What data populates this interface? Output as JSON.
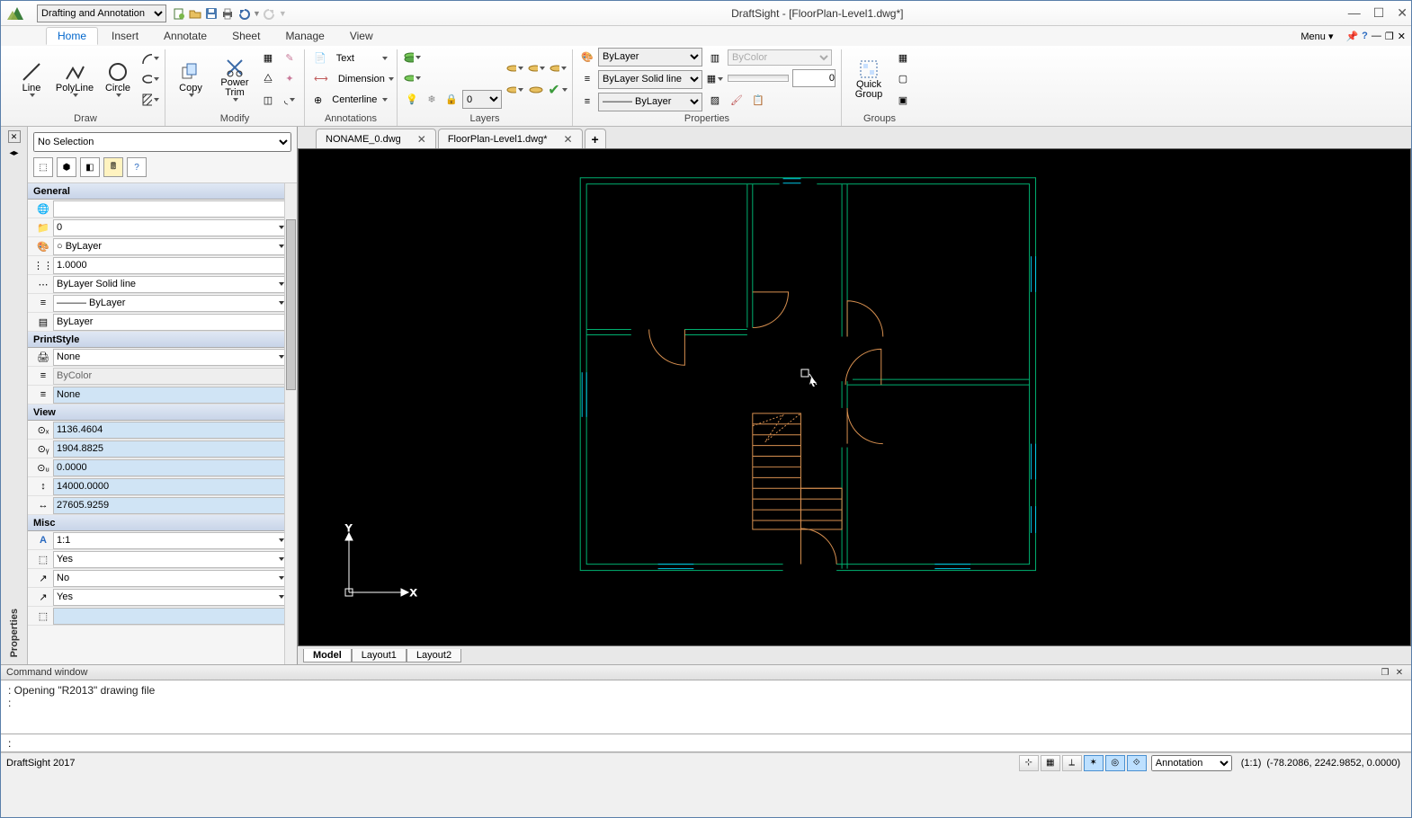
{
  "app_title": "DraftSight - [FloorPlan-Level1.dwg*]",
  "workspace": "Drafting and Annotation",
  "menu_label": "Menu",
  "ribbon_tabs": [
    "Home",
    "Insert",
    "Annotate",
    "Sheet",
    "Manage",
    "View"
  ],
  "active_ribbon_tab": 0,
  "ribbon": {
    "draw": {
      "label": "Draw",
      "line": "Line",
      "polyline": "PolyLine",
      "circle": "Circle"
    },
    "modify": {
      "label": "Modify",
      "copy": "Copy",
      "powertrim": "Power Trim"
    },
    "annotations": {
      "label": "Annotations",
      "text": "Text",
      "dimension": "Dimension",
      "centerline": "Centerline"
    },
    "layers": {
      "label": "Layers",
      "active": "0"
    },
    "properties": {
      "label": "Properties",
      "color": "ByLayer",
      "linestyle": "ByLayer    Solid line",
      "lineweight": "——— ByLayer",
      "bycolor": "ByColor",
      "transparency": "0"
    },
    "groups": {
      "label": "Groups",
      "quick": "Quick Group"
    }
  },
  "doc_tabs": [
    {
      "label": "NONAME_0.dwg",
      "closable": true
    },
    {
      "label": "FloorPlan-Level1.dwg*",
      "closable": true
    }
  ],
  "sheet_tabs": [
    "Model",
    "Layout1",
    "Layout2"
  ],
  "active_sheet": 0,
  "props": {
    "selection": "No Selection",
    "cats": {
      "general": "General",
      "printstyle": "PrintStyle",
      "view": "View",
      "misc": "Misc"
    },
    "general": {
      "empty": "",
      "layer": "0",
      "color": "○ ByLayer",
      "scale": "1.0000",
      "linestyle": "ByLayer    Solid line",
      "lineweight": "——— ByLayer",
      "lw2": "ByLayer"
    },
    "printstyle": {
      "p1": "None",
      "p2": "ByColor",
      "p3": "None"
    },
    "view": {
      "cx": "1136.4604",
      "cy": "1904.8825",
      "cz": "0.0000",
      "h": "14000.0000",
      "w": "27605.9259"
    },
    "misc": {
      "scale": "1:1",
      "m1": "Yes",
      "m2": "No",
      "m3": "Yes"
    }
  },
  "cmd_window_label": "Command window",
  "cmd_log": ": Opening \"R2013\" drawing file\n:",
  "cmd_prompt": ":",
  "status": {
    "product": "DraftSight 2017",
    "annotation": "Annotation",
    "scale": "(1:1)",
    "coords": "(-78.2086, 2242.9852, 0.0000)"
  }
}
